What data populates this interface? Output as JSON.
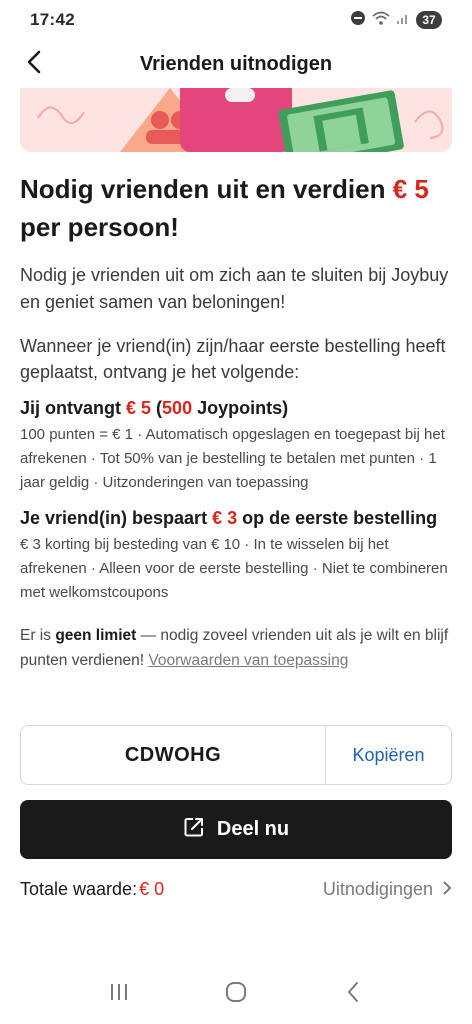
{
  "status_bar": {
    "time": "17:42",
    "battery": "37"
  },
  "header": {
    "title": "Vrienden uitnodigen"
  },
  "heading": {
    "line_a": "Nodig vrienden uit en verdien ",
    "amount": "€ 5",
    "line_b": " per persoon!"
  },
  "intro": "Nodig je vrienden uit om zich aan te sluiten bij Joybuy en geniet samen van beloningen!",
  "when_text": "Wanneer je vriend(in) zijn/haar eerste bestelling heeft geplaatst, ontvang je het volgende:",
  "you_receive": {
    "prefix": "Jij ontvangt ",
    "amount": "€ 5",
    "open": " (",
    "points": "500",
    "suffix": " Joypoints)",
    "detail": "100 punten = € 1 · Automatisch opgeslagen en toegepast bij het afrekenen · Tot 50% van je bestelling te betalen met punten · 1 jaar geldig · Uitzonderingen van toepassing"
  },
  "friend_saves": {
    "prefix": "Je vriend(in) bespaart ",
    "amount": "€ 3",
    "suffix": " op de eerste bestelling",
    "detail": "€ 3 korting bij besteding van € 10 · In te wisselen bij het afrekenen · Alleen voor de eerste bestelling · Niet te combineren met welkomstcoupons"
  },
  "limit": {
    "prefix": "Er is ",
    "bold": "geen limiet",
    "middle": " — nodig zoveel vrienden uit als je wilt en blijf punten verdienen! ",
    "link": "Voorwaarden van toepassing"
  },
  "invite_code": {
    "code": "CDWOHG",
    "copy_label": "Kopiëren"
  },
  "share": {
    "label": "Deel nu"
  },
  "totals": {
    "label": "Totale waarde:",
    "amount": "€ 0",
    "invites_label": "Uitnodigingen"
  },
  "colors": {
    "accent": "#d9261c",
    "link_blue": "#1f5fb8",
    "dark": "#1a1a1a"
  },
  "icons": {
    "back": "chevron-left-icon",
    "share": "external-share-icon",
    "invites": "chevron-right-icon",
    "nav_recent": "recent-apps-icon",
    "nav_home": "home-icon",
    "nav_back": "nav-back-icon"
  }
}
